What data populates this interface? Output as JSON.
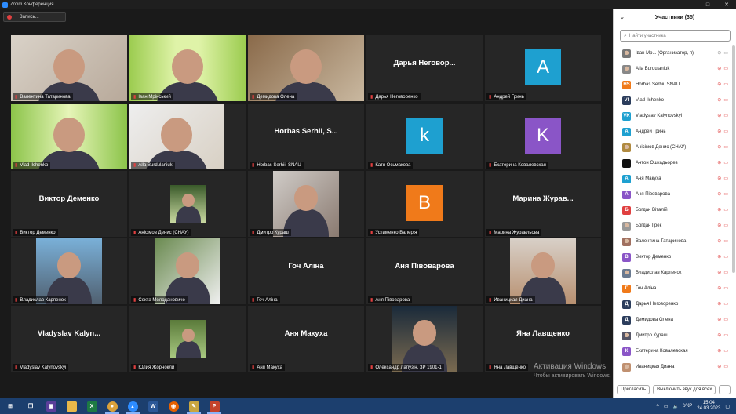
{
  "window": {
    "title": "Zoom Конференция",
    "controls": [
      "—",
      "□",
      "✕"
    ]
  },
  "recording": {
    "label": "Запись..."
  },
  "watermark": {
    "line1": "Активация Windows",
    "line2": "Чтобы активировать Windows, перейдите в раздел \"Параметры\"."
  },
  "tiles": [
    {
      "label": "Валентина Татаринова",
      "type": "photo"
    },
    {
      "label": "Іван Мрінський",
      "type": "photo",
      "active": true
    },
    {
      "label": "Демидова Олена",
      "type": "photo"
    },
    {
      "label": "Дарья Неговоренко",
      "type": "name",
      "display": "Дарья Неговор..."
    },
    {
      "label": "Андрей Гринь",
      "type": "avatar",
      "letter": "А",
      "color": "#1ea0d0"
    },
    {
      "label": "Vlad Ilchenko",
      "type": "photo"
    },
    {
      "label": "Alla Burdulaniuk",
      "type": "photo"
    },
    {
      "label": "Horbas Serhii, SNAU",
      "type": "name",
      "display": "Horbas Serhii, S..."
    },
    {
      "label": "Катя Осьмакова",
      "type": "avatar",
      "letter": "k",
      "color": "#1ea0d0"
    },
    {
      "label": "Екатерина Ковалевская",
      "type": "avatar",
      "letter": "K",
      "color": "#8a55c7"
    },
    {
      "label": "Виктор Деменко",
      "type": "name",
      "display": "Виктор Деменко"
    },
    {
      "label": "Анісімов Денис (СНАУ)",
      "type": "photo"
    },
    {
      "label": "Дмитро Кураш",
      "type": "photo"
    },
    {
      "label": "Устименко Валерія",
      "type": "avatar",
      "letter": "B",
      "color": "#f07a1a"
    },
    {
      "label": "Марина Журавльова",
      "type": "name",
      "display": "Марина Журав..."
    },
    {
      "label": "Владислав Карпенок",
      "type": "photo"
    },
    {
      "label": "Секта Молодановиче",
      "type": "photo"
    },
    {
      "label": "Гоч Аліна",
      "type": "name",
      "display": "Гоч Аліна"
    },
    {
      "label": "Аня Пiвоварова",
      "type": "name",
      "display": "Аня Півоварова"
    },
    {
      "label": "Иваницкая Диана",
      "type": "photo"
    },
    {
      "label": "Vladyslav Kalynovskyi",
      "type": "name",
      "display": "Vladyslav Kalyn..."
    },
    {
      "label": "Юлия Жорноклй",
      "type": "photo"
    },
    {
      "label": "Аня Макуха",
      "type": "name",
      "display": "Аня Макуха"
    },
    {
      "label": "Олександр Лапузін, ЗР 1901-1",
      "type": "photo"
    },
    {
      "label": "Яна Лавщенко",
      "type": "name",
      "display": "Яна Лавщенко"
    }
  ],
  "panel": {
    "title": "Участники (35)",
    "search_placeholder": "Найти участника",
    "participants": [
      {
        "name": "Іван Мр...  (Организатор, я)",
        "av": "",
        "color": "#777",
        "photo": true
      },
      {
        "name": "Alla Burdulaniuk",
        "av": "",
        "color": "#888",
        "photo": true
      },
      {
        "name": "Horbas Serhii, SNAU",
        "av": "HS",
        "color": "#f07a1a"
      },
      {
        "name": "Vlad Ilchenko",
        "av": "VI",
        "color": "#2b3d5c"
      },
      {
        "name": "Vladyslav Kalynovskyi",
        "av": "VK",
        "color": "#1ea0d0"
      },
      {
        "name": "Андрей Гринь",
        "av": "А",
        "color": "#1ea0d0"
      },
      {
        "name": "Анісімов Денис (СНАУ)",
        "av": "",
        "color": "#b08a40",
        "photo": true
      },
      {
        "name": "Антон Ошкадьорев",
        "av": "",
        "color": "#111"
      },
      {
        "name": "Аня Макуха",
        "av": "А",
        "color": "#1ea0d0"
      },
      {
        "name": "Аня Півоварова",
        "av": "А",
        "color": "#8a55c7"
      },
      {
        "name": "Богдан Віталій",
        "av": "Б",
        "color": "#e04040"
      },
      {
        "name": "Богдан Грек",
        "av": "",
        "color": "#999",
        "photo": true
      },
      {
        "name": "Валентина Татаринова",
        "av": "",
        "color": "#a07060",
        "photo": true
      },
      {
        "name": "Виктор Деменко",
        "av": "В",
        "color": "#8a55c7"
      },
      {
        "name": "Владислав Карпенок",
        "av": "",
        "color": "#6a7a90",
        "photo": true
      },
      {
        "name": "Гоч Аліна",
        "av": "Г",
        "color": "#f07a1a"
      },
      {
        "name": "Дарья Неговоренко",
        "av": "Д",
        "color": "#2b3d5c"
      },
      {
        "name": "Демидова Олена",
        "av": "Д",
        "color": "#2b3d5c"
      },
      {
        "name": "Дмитро Кураш",
        "av": "",
        "color": "#556",
        "photo": true
      },
      {
        "name": "Екатерина Ковалевская",
        "av": "К",
        "color": "#8a55c7"
      },
      {
        "name": "Иваницкая Диана",
        "av": "",
        "color": "#c09070",
        "photo": true
      }
    ],
    "invite": "Пригласить",
    "mute_all": "Выключить звук для всех",
    "more": "..."
  },
  "taskbar": {
    "lang": "УКР",
    "time": "15:04",
    "date": "24.03.2023"
  }
}
